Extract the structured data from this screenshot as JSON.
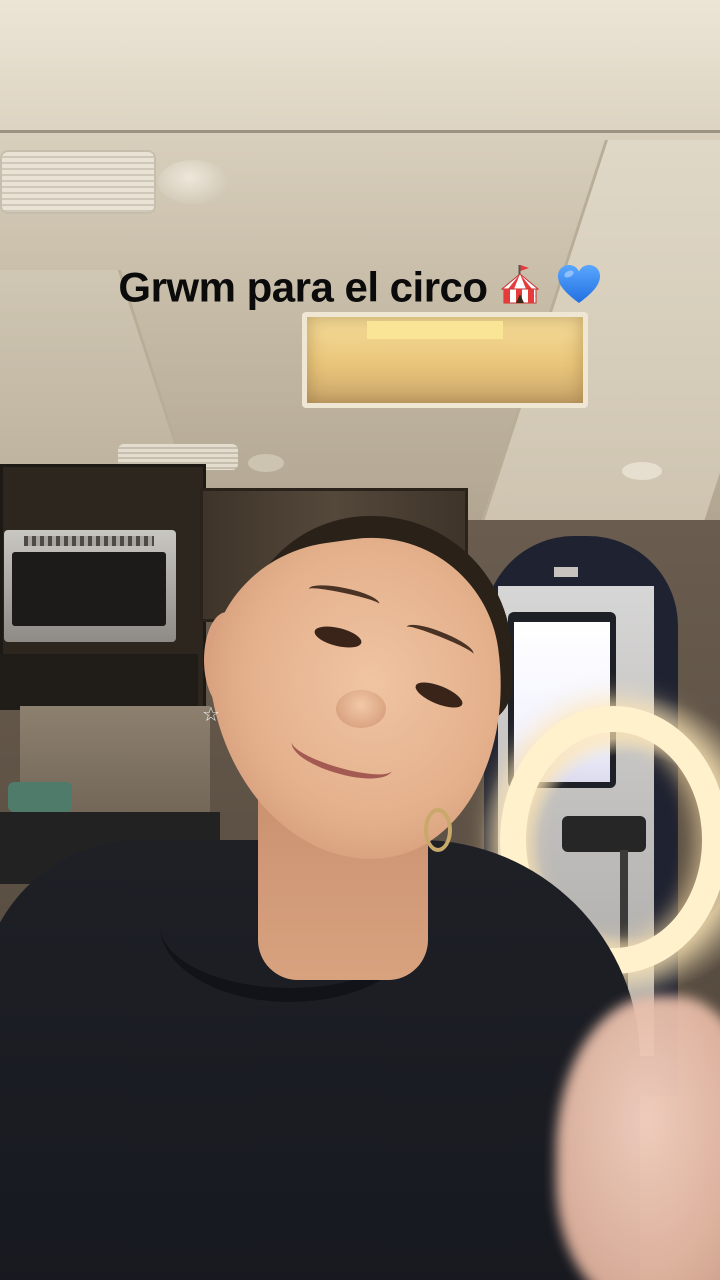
{
  "overlay": {
    "caption": "Grwm para el circo",
    "emojis": [
      "circus-tent-icon",
      "blue-heart-icon"
    ]
  },
  "colors": {
    "caption_text": "#0b0b0b",
    "heart": "#3d8bf2",
    "ring_light": "#fff1cc"
  }
}
